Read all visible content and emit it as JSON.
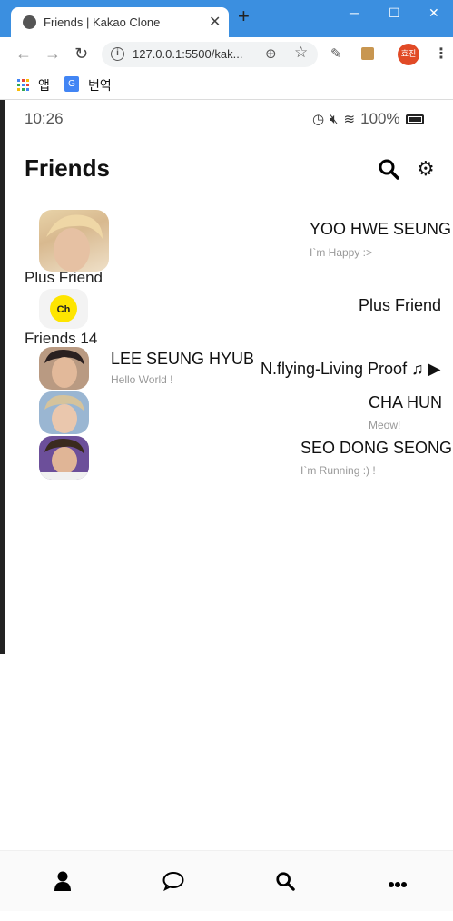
{
  "browser": {
    "tab_title": "Friends | Kakao Clone",
    "url": "127.0.0.1:5500/kak...",
    "profile_label": "효진",
    "bookmarks": [
      {
        "label": "앱",
        "icon": "apps-grid-icon"
      },
      {
        "label": "번역",
        "icon": "google-translate-icon"
      }
    ],
    "accent_color": "#3b8fe0"
  },
  "status_bar": {
    "time": "10:26",
    "battery": "100%"
  },
  "header": {
    "title": "Friends"
  },
  "my_profile": {
    "name": "YOO HWE SEUNG",
    "status": "I`m Happy :>"
  },
  "plus_friend_section": {
    "title": "Plus Friend",
    "item_name": "Plus Friend",
    "icon_text": "Ch",
    "icon_color": "#fee500"
  },
  "friends_section": {
    "title": "Friends 14",
    "friends": [
      {
        "name": "LEE SEUNG HYUB",
        "status": "Hello World !",
        "music": "N.flying-Living Proof ♫ ▶"
      },
      {
        "name": "CHA HUN",
        "status": "Meow!"
      },
      {
        "name": "SEO DONG SEONG",
        "status": "I`m Running :) !"
      }
    ]
  },
  "bottom_nav": [
    {
      "icon": "user-icon"
    },
    {
      "icon": "chat-bubble-icon"
    },
    {
      "icon": "search-icon"
    },
    {
      "icon": "more-dots-icon"
    }
  ]
}
